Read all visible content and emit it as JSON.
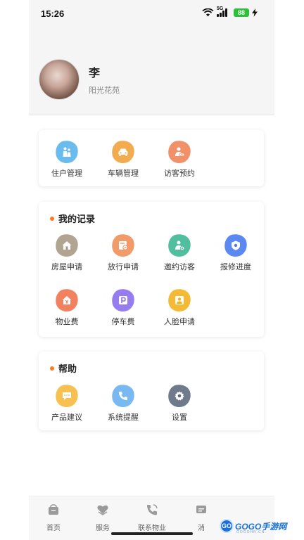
{
  "status_bar": {
    "time": "15:26",
    "network": "5G",
    "battery": "88"
  },
  "profile": {
    "name": "李",
    "community": "阳光花苑"
  },
  "quick_actions": [
    {
      "label": "住户管理",
      "icon": "residents-icon",
      "color": "#5bb5ec"
    },
    {
      "label": "车辆管理",
      "icon": "car-icon",
      "color": "#f2a23c"
    },
    {
      "label": "访客预约",
      "icon": "visitor-eye-icon",
      "color": "#f0855a"
    }
  ],
  "records": {
    "title": "我的记录",
    "items": [
      {
        "label": "房屋申请",
        "icon": "house-icon",
        "color": "#a99b86"
      },
      {
        "label": "放行申请",
        "icon": "release-icon",
        "color": "#ef8f5a"
      },
      {
        "label": "邀约访客",
        "icon": "invite-visitor-icon",
        "color": "#3fb796"
      },
      {
        "label": "报修进度",
        "icon": "repair-shield-icon",
        "color": "#4a7bef"
      },
      {
        "label": "物业费",
        "icon": "property-fee-icon",
        "color": "#f0734e"
      },
      {
        "label": "停车费",
        "icon": "parking-icon",
        "color": "#8a6ef0"
      },
      {
        "label": "人脸申请",
        "icon": "face-icon",
        "color": "#f3b21f"
      }
    ]
  },
  "help": {
    "title": "帮助",
    "items": [
      {
        "label": "产品建议",
        "icon": "suggestion-icon",
        "color": "#f7b93e"
      },
      {
        "label": "系统提醒",
        "icon": "phone-reminder-icon",
        "color": "#6ab1ef"
      },
      {
        "label": "设置",
        "icon": "gear-icon",
        "color": "#5f6b7f"
      }
    ]
  },
  "bottom_nav": [
    {
      "label": "首页",
      "icon": "home-icon"
    },
    {
      "label": "服务",
      "icon": "service-icon"
    },
    {
      "label": "联系物业",
      "icon": "contact-phone-icon"
    },
    {
      "label": "消",
      "icon": "message-icon"
    }
  ],
  "watermark": {
    "brand": "GOGO手游网",
    "logo": "GO",
    "sub": "GOGOHR.CN"
  }
}
